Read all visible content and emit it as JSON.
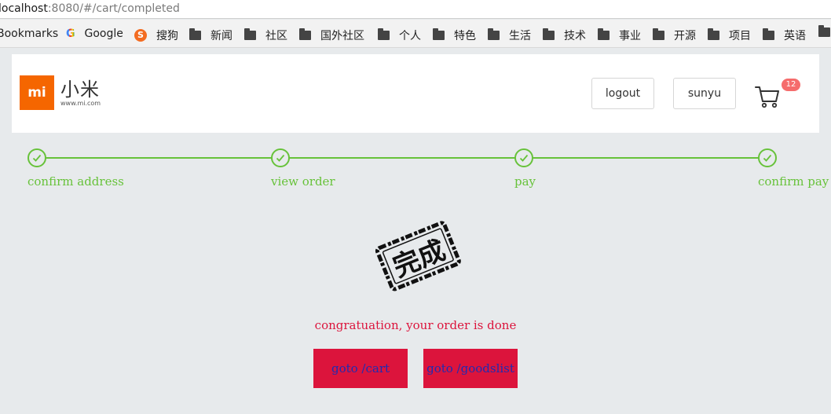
{
  "browser": {
    "url_host": "localhost",
    "url_rest": ":8080/#/cart/completed",
    "bookmarks": [
      {
        "label": "Bookmarks",
        "icon": "none"
      },
      {
        "label": "Google",
        "icon": "google-icon"
      },
      {
        "label": "搜狗",
        "icon": "sogou-icon"
      },
      {
        "label": "新闻",
        "icon": "folder-icon"
      },
      {
        "label": "社区",
        "icon": "folder-icon"
      },
      {
        "label": "国外社区",
        "icon": "folder-icon"
      },
      {
        "label": "个人",
        "icon": "folder-icon"
      },
      {
        "label": "特色",
        "icon": "folder-icon"
      },
      {
        "label": "生活",
        "icon": "folder-icon"
      },
      {
        "label": "技术",
        "icon": "folder-icon"
      },
      {
        "label": "事业",
        "icon": "folder-icon"
      },
      {
        "label": "开源",
        "icon": "folder-icon"
      },
      {
        "label": "项目",
        "icon": "folder-icon"
      },
      {
        "label": "英语",
        "icon": "folder-icon"
      }
    ]
  },
  "header": {
    "logo_mark": "mi",
    "logo_cn": "小米",
    "logo_url": "www.mi.com",
    "logout_label": "logout",
    "user_label": "sunyu",
    "cart_count": "12"
  },
  "steps": [
    {
      "label": "confirm address"
    },
    {
      "label": "view order"
    },
    {
      "label": "pay"
    },
    {
      "label": "confirm pay"
    }
  ],
  "stamp_text": "完成",
  "message": "congratuation, your order is done",
  "buttons": {
    "cart": "goto /cart",
    "goods": "goto /goodslist"
  },
  "colors": {
    "step_green": "#67c23a",
    "accent_red": "#dc143c",
    "badge": "#f56c6c",
    "brand_orange": "#f56600"
  }
}
